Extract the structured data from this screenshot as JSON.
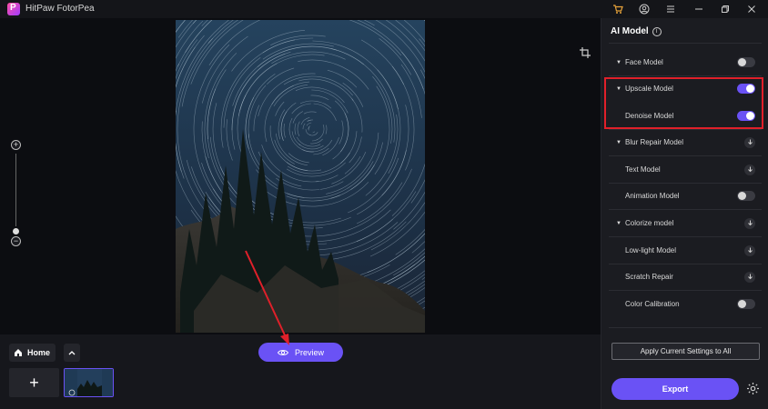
{
  "window": {
    "title": "HitPaw FotorPea",
    "icons": [
      "cart-icon",
      "account-icon",
      "menu-icon",
      "minimize-icon",
      "restore-icon",
      "close-icon"
    ]
  },
  "canvas": {
    "zoom_icons": [
      "zoom-in-icon",
      "zoom-out-icon"
    ],
    "crop_icon": "crop-icon"
  },
  "bottom": {
    "home_label": "Home",
    "preview_label": "Preview",
    "add_symbol": "+"
  },
  "panel": {
    "title": "AI Model",
    "models": [
      {
        "label": "Face Model",
        "control": "toggle",
        "on": false,
        "caret": true
      },
      {
        "label": "Upscale Model",
        "control": "toggle",
        "on": true,
        "caret": true
      },
      {
        "label": "Denoise Model",
        "control": "toggle",
        "on": true,
        "caret": false
      },
      {
        "label": "Blur Repair Model",
        "control": "download",
        "caret": true
      },
      {
        "label": "Text Model",
        "control": "download",
        "caret": false
      },
      {
        "label": "Animation Model",
        "control": "toggle",
        "on": false,
        "caret": false
      },
      {
        "label": "Colorize model",
        "control": "download",
        "caret": true
      },
      {
        "label": "Low-light Model",
        "control": "download",
        "caret": false
      },
      {
        "label": "Scratch Repair",
        "control": "download",
        "caret": false
      },
      {
        "label": "Color Calibration",
        "control": "toggle",
        "on": false,
        "caret": false
      }
    ],
    "apply_label": "Apply Current Settings to All",
    "export_label": "Export"
  },
  "colors": {
    "accent": "#6a52f5",
    "highlight": "#e0202a"
  }
}
